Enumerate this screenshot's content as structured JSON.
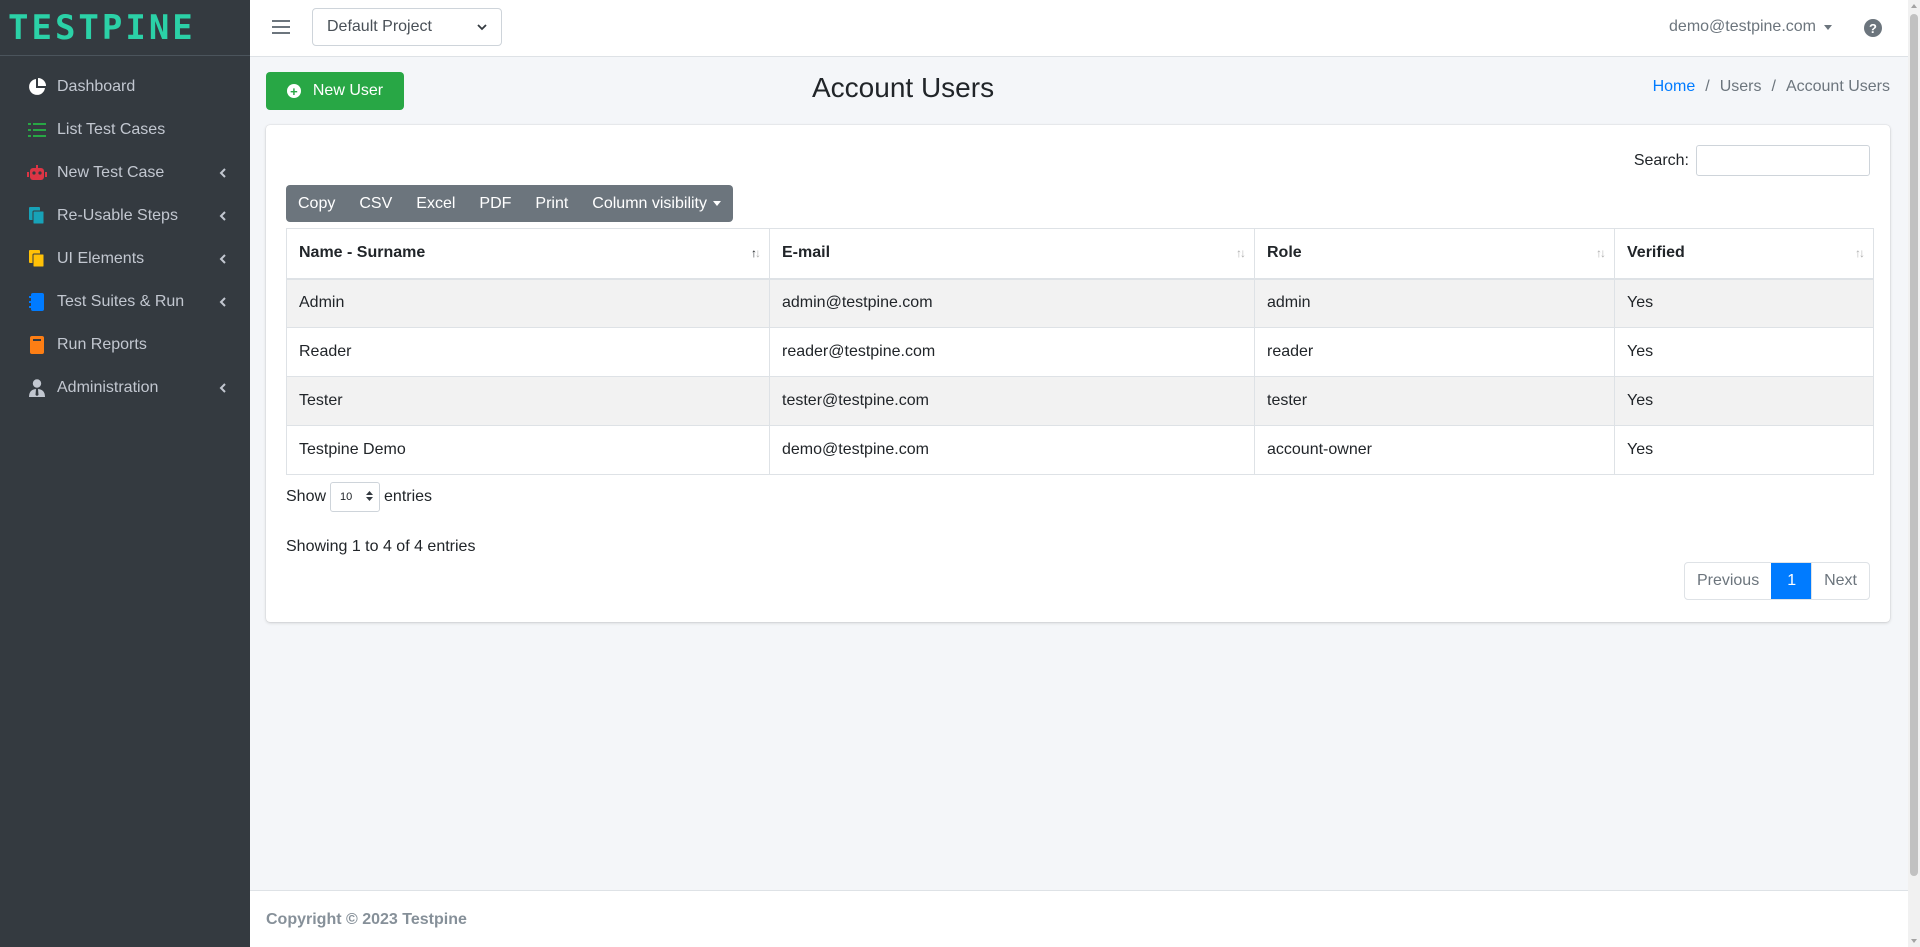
{
  "brand": {
    "name": "TESTPINE",
    "color": "#2bd1a7"
  },
  "sidebar": {
    "items": [
      {
        "label": "Dashboard",
        "icon": "pie-chart-icon",
        "color": "#ffffff",
        "has_submenu": false
      },
      {
        "label": "List Test Cases",
        "icon": "list-icon",
        "color": "#28a745",
        "has_submenu": false
      },
      {
        "label": "New Test Case",
        "icon": "robot-icon",
        "color": "#dc3545",
        "has_submenu": true
      },
      {
        "label": "Re-Usable Steps",
        "icon": "copy-icon",
        "color": "#17a2b8",
        "has_submenu": true
      },
      {
        "label": "UI Elements",
        "icon": "files-icon",
        "color": "#ffc107",
        "has_submenu": true
      },
      {
        "label": "Test Suites & Run",
        "icon": "notebook-icon",
        "color": "#007bff",
        "has_submenu": true
      },
      {
        "label": "Run Reports",
        "icon": "book-icon",
        "color": "#fd7e14",
        "has_submenu": false
      },
      {
        "label": "Administration",
        "icon": "user-tie-icon",
        "color": "#c2c7d0",
        "has_submenu": true
      }
    ]
  },
  "topbar": {
    "project": "Default Project",
    "user_email": "demo@testpine.com",
    "help_glyph": "?"
  },
  "header": {
    "new_user_label": "New User",
    "title": "Account Users",
    "breadcrumb": [
      "Home",
      "Users",
      "Account Users"
    ]
  },
  "table_tools": {
    "search_label": "Search:",
    "search_value": "",
    "buttons": [
      "Copy",
      "CSV",
      "Excel",
      "PDF",
      "Print",
      "Column visibility"
    ]
  },
  "table": {
    "columns": [
      "Name - Surname",
      "E-mail",
      "Role",
      "Verified"
    ],
    "rows": [
      [
        "Admin",
        "admin@testpine.com",
        "admin",
        "Yes"
      ],
      [
        "Reader",
        "reader@testpine.com",
        "reader",
        "Yes"
      ],
      [
        "Tester",
        "tester@testpine.com",
        "tester",
        "Yes"
      ],
      [
        "Testpine Demo",
        "demo@testpine.com",
        "account-owner",
        "Yes"
      ]
    ]
  },
  "length": {
    "show": "Show",
    "value": "10",
    "entries": "entries"
  },
  "info": "Showing 1 to 4 of 4 entries",
  "pagination": {
    "previous": "Previous",
    "current": "1",
    "next": "Next"
  },
  "footer": {
    "text": "Copyright © 2023 Testpine"
  },
  "colors": {
    "accent": "#007bff",
    "success": "#28a745",
    "sidebar_bg": "#343a40"
  }
}
